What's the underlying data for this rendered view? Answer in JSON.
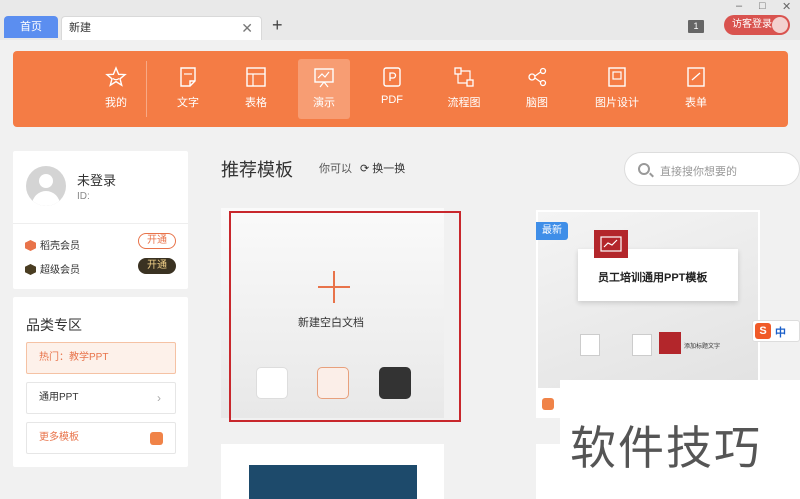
{
  "tabs": {
    "home": "首页",
    "new": "新建",
    "close": "✕",
    "add": "+"
  },
  "window": {
    "minimize": "–",
    "maximize": "□",
    "close": "✕",
    "badge": "1"
  },
  "guest": {
    "label": "访客登录"
  },
  "toolbar": {
    "items": [
      {
        "label": "我的",
        "icon": "star-icon"
      },
      {
        "label": "文字",
        "icon": "document-icon"
      },
      {
        "label": "表格",
        "icon": "table-icon"
      },
      {
        "label": "演示",
        "icon": "presentation-icon",
        "active": true
      },
      {
        "label": "PDF",
        "icon": "pdf-icon"
      },
      {
        "label": "流程图",
        "icon": "flowchart-icon"
      },
      {
        "label": "脑图",
        "icon": "mindmap-icon"
      },
      {
        "label": "图片设计",
        "icon": "image-design-icon"
      },
      {
        "label": "表单",
        "icon": "form-icon"
      }
    ]
  },
  "user": {
    "name": "未登录",
    "id_label": "ID:",
    "memberships": [
      {
        "label": "稻壳会员",
        "button": "开通",
        "color": "#e8734a"
      },
      {
        "label": "超级会员",
        "button": "开通",
        "color": "#4a3d22"
      }
    ]
  },
  "category": {
    "title": "品类专区",
    "items": [
      {
        "label": "热门：教学PPT"
      },
      {
        "label": "通用PPT"
      },
      {
        "label": "更多模板"
      }
    ]
  },
  "main": {
    "title": "推荐模板",
    "can_text": "你可以",
    "refresh": "换一换",
    "search_placeholder": "直接搜你想要的"
  },
  "blank": {
    "label": "新建空白文档",
    "swatches": [
      "#ffffff",
      "#fbeee8",
      "#333333"
    ]
  },
  "template": {
    "badge": "最新",
    "title": "员工培训通用PPT模板",
    "mini_text": "添加标题文字"
  },
  "ime": {
    "icon": "S",
    "label": "中"
  },
  "watermark": "软件技巧",
  "colors": {
    "accent": "#f47c45",
    "tab_blue": "#5b8ef0",
    "highlight": "#c8272c"
  }
}
